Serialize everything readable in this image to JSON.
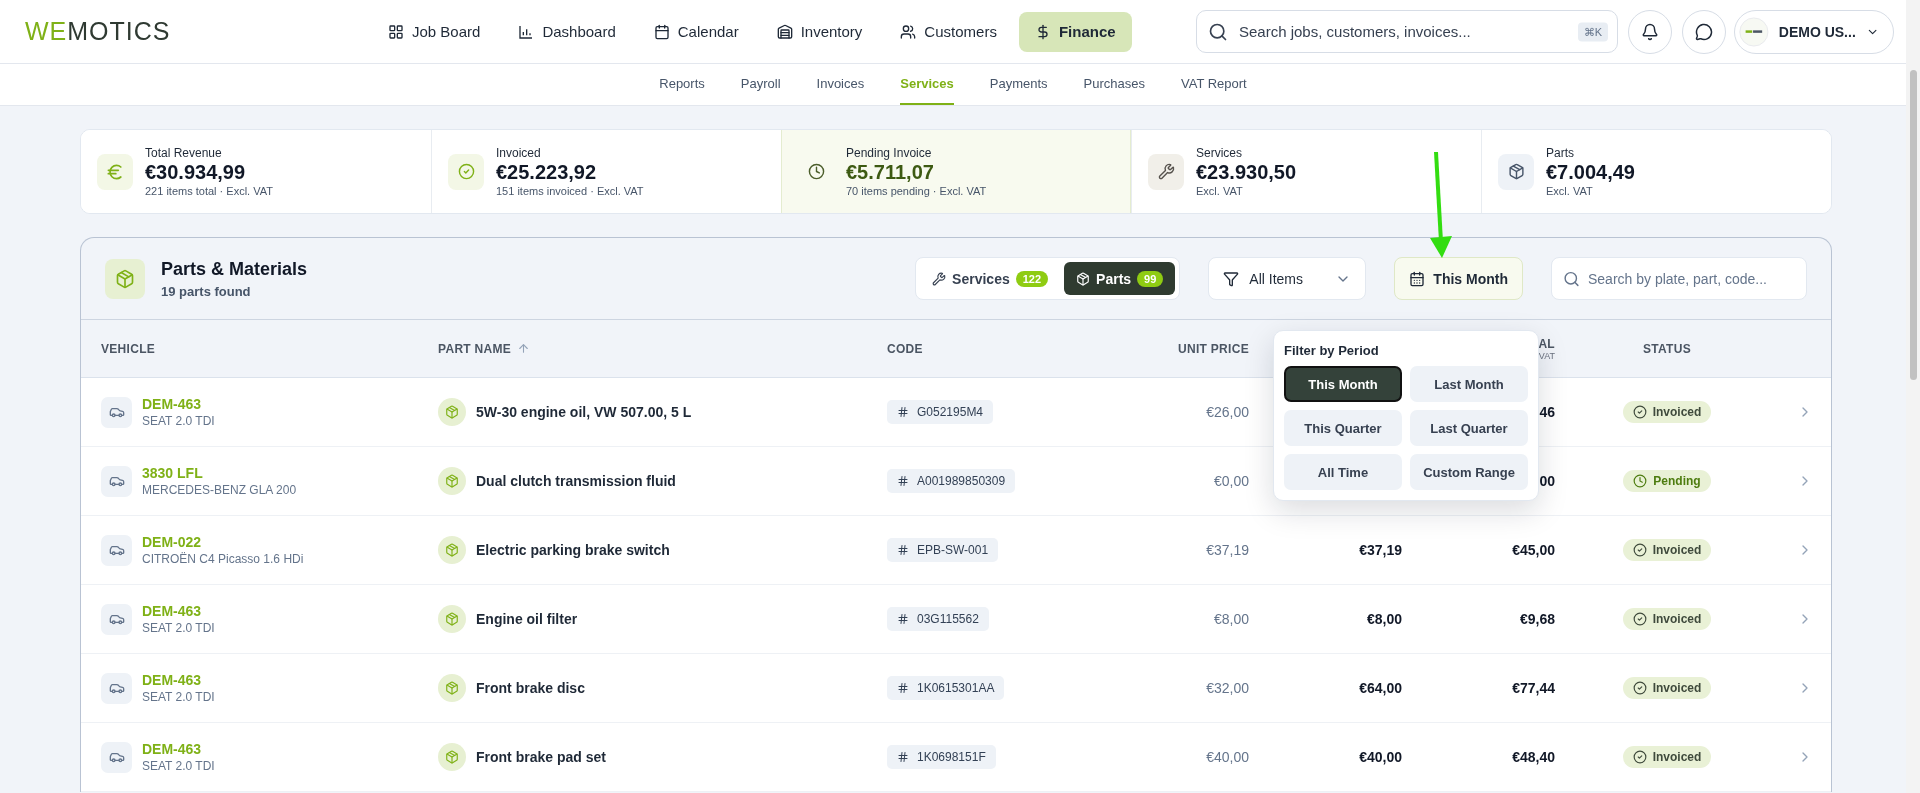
{
  "logo": {
    "accent": "WE",
    "rest": "MOTICS"
  },
  "nav": [
    {
      "label": "Job Board",
      "kind": "grid",
      "selected": false
    },
    {
      "label": "Dashboard",
      "kind": "chart",
      "selected": false
    },
    {
      "label": "Calendar",
      "kind": "calendar",
      "selected": false
    },
    {
      "label": "Inventory",
      "kind": "warehouse",
      "selected": false
    },
    {
      "label": "Customers",
      "kind": "users",
      "selected": false
    },
    {
      "label": "Finance",
      "kind": "dollar",
      "selected": true
    }
  ],
  "search": {
    "placeholder": "Search jobs, customers, invoices...",
    "shortcut": "⌘K"
  },
  "user": {
    "name": "DEMO US..."
  },
  "subnav": [
    {
      "label": "Reports",
      "selected": false
    },
    {
      "label": "Payroll",
      "selected": false
    },
    {
      "label": "Invoices",
      "selected": false
    },
    {
      "label": "Services",
      "selected": true
    },
    {
      "label": "Payments",
      "selected": false
    },
    {
      "label": "Purchases",
      "selected": false
    },
    {
      "label": "VAT Report",
      "selected": false
    }
  ],
  "stats": [
    {
      "kind": "revenue",
      "label": "Total Revenue",
      "value": "€30.934,99",
      "sub": "221 items total · Excl. VAT",
      "highlighted": false
    },
    {
      "kind": "invoiced",
      "label": "Invoiced",
      "value": "€25.223,92",
      "sub": "151 items invoiced · Excl. VAT",
      "highlighted": false
    },
    {
      "kind": "pending",
      "label": "Pending Invoice",
      "value": "€5.711,07",
      "sub": "70 items pending · Excl. VAT",
      "highlighted": true
    },
    {
      "kind": "services",
      "label": "Services",
      "value": "€23.930,50",
      "sub": "Excl. VAT",
      "highlighted": false
    },
    {
      "kind": "parts",
      "label": "Parts",
      "value": "€7.004,49",
      "sub": "Excl. VAT",
      "highlighted": false
    }
  ],
  "panel": {
    "title": "Parts & Materials",
    "subtitle": "19 parts found"
  },
  "toggle": [
    {
      "kind": "services",
      "label": "Services",
      "count": "122",
      "selected": false
    },
    {
      "kind": "parts",
      "label": "Parts",
      "count": "99",
      "selected": true
    }
  ],
  "item_filter": {
    "value": "All Items"
  },
  "period_button": {
    "label": "This Month"
  },
  "table_search": {
    "placeholder": "Search by plate, part, code..."
  },
  "period_menu": {
    "title": "Filter by Period",
    "options": [
      {
        "label": "This Month",
        "selected": true
      },
      {
        "label": "Last Month",
        "selected": false
      },
      {
        "label": "This Quarter",
        "selected": false
      },
      {
        "label": "Last Quarter",
        "selected": false
      },
      {
        "label": "All Time",
        "selected": false
      },
      {
        "label": "Custom Range",
        "selected": false
      }
    ]
  },
  "table": {
    "columns": [
      {
        "label": "VEHICLE"
      },
      {
        "label": "PART NAME",
        "sorted": true
      },
      {
        "label": "CODE"
      },
      {
        "label": "UNIT PRICE"
      },
      {},
      {
        "label": "AL",
        "sublabel": "VAT"
      },
      {
        "label": "STATUS"
      }
    ],
    "rows": [
      {
        "plate": "DEM-463",
        "model": "SEAT 2.0 TDI",
        "part": "5W-30 engine oil, VW 507.00, 5 L",
        "code": "G052195M4",
        "unit_price": "€26,00",
        "column_5": "46",
        "status": {
          "kind": "invoiced",
          "label": "Invoiced"
        }
      },
      {
        "plate": "3830 LFL",
        "model": "MERCEDES-BENZ GLA 200",
        "part": "Dual clutch transmission fluid",
        "code": "A001989850309",
        "unit_price": "€0,00",
        "column_5": "00",
        "status": {
          "kind": "pending",
          "label": "Pending"
        }
      },
      {
        "plate": "DEM-022",
        "model": "CITROËN C4 Picasso 1.6 HDi",
        "part": "Electric parking brake switch",
        "code": "EPB-SW-001",
        "unit_price": "€37,19",
        "column_4": "€37,19",
        "column_5": "€45,00",
        "status": {
          "kind": "invoiced",
          "label": "Invoiced"
        }
      },
      {
        "plate": "DEM-463",
        "model": "SEAT 2.0 TDI",
        "part": "Engine oil filter",
        "code": "03G115562",
        "unit_price": "€8,00",
        "column_4": "€8,00",
        "column_5": "€9,68",
        "status": {
          "kind": "invoiced",
          "label": "Invoiced"
        }
      },
      {
        "plate": "DEM-463",
        "model": "SEAT 2.0 TDI",
        "part": "Front brake disc",
        "code": "1K0615301AA",
        "unit_price": "€32,00",
        "column_4": "€64,00",
        "column_5": "€77,44",
        "status": {
          "kind": "invoiced",
          "label": "Invoiced"
        }
      },
      {
        "plate": "DEM-463",
        "model": "SEAT 2.0 TDI",
        "part": "Front brake pad set",
        "code": "1K0698151F",
        "unit_price": "€40,00",
        "column_4": "€40,00",
        "column_5": "€48,40",
        "status": {
          "kind": "invoiced",
          "label": "Invoiced"
        }
      }
    ]
  }
}
